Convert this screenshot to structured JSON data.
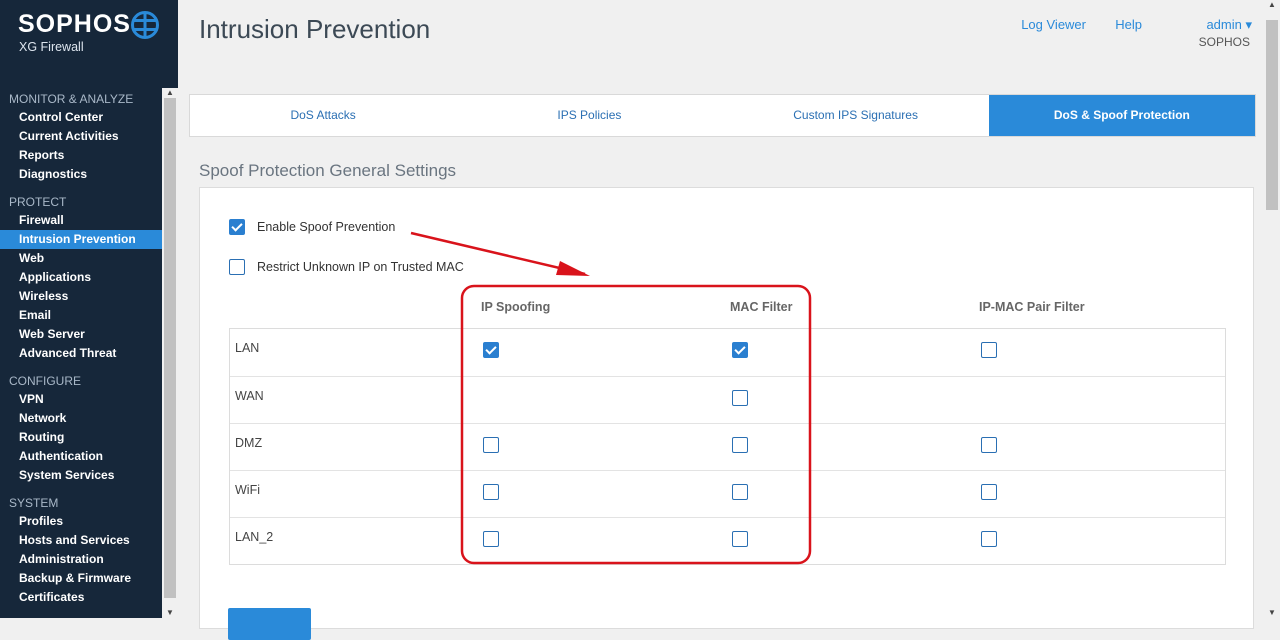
{
  "brand": {
    "name": "SOPHOS",
    "product": "XG Firewall"
  },
  "nav": [
    {
      "heading": "MONITOR & ANALYZE",
      "items": [
        "Control Center",
        "Current Activities",
        "Reports",
        "Diagnostics"
      ]
    },
    {
      "heading": "PROTECT",
      "items": [
        "Firewall",
        "Intrusion Prevention",
        "Web",
        "Applications",
        "Wireless",
        "Email",
        "Web Server",
        "Advanced Threat"
      ]
    },
    {
      "heading": "CONFIGURE",
      "items": [
        "VPN",
        "Network",
        "Routing",
        "Authentication",
        "System Services"
      ]
    },
    {
      "heading": "SYSTEM",
      "items": [
        "Profiles",
        "Hosts and Services",
        "Administration",
        "Backup & Firmware",
        "Certificates"
      ]
    }
  ],
  "active_nav": "Intrusion Prevention",
  "page_title": "Intrusion Prevention",
  "top_links": {
    "log_viewer": "Log Viewer",
    "help": "Help",
    "admin": "admin ▾",
    "org": "SOPHOS"
  },
  "tabs": [
    "DoS Attacks",
    "IPS Policies",
    "Custom IPS Signatures",
    "DoS & Spoof Protection"
  ],
  "active_tab": "DoS & Spoof Protection",
  "section_title": "Spoof Protection General Settings",
  "options": {
    "enable_spoof": {
      "label": "Enable Spoof Prevention",
      "checked": true
    },
    "restrict_unknown": {
      "label": "Restrict Unknown IP on Trusted MAC",
      "checked": false
    }
  },
  "columns": [
    "IP Spoofing",
    "MAC Filter",
    "IP-MAC Pair Filter"
  ],
  "rows": [
    {
      "zone": "LAN",
      "ip_spoofing": true,
      "mac_filter": true,
      "ip_mac_pair": false
    },
    {
      "zone": "WAN",
      "ip_spoofing": null,
      "mac_filter": false,
      "ip_mac_pair": null
    },
    {
      "zone": "DMZ",
      "ip_spoofing": false,
      "mac_filter": false,
      "ip_mac_pair": false
    },
    {
      "zone": "WiFi",
      "ip_spoofing": false,
      "mac_filter": false,
      "ip_mac_pair": false
    },
    {
      "zone": "LAN_2",
      "ip_spoofing": false,
      "mac_filter": false,
      "ip_mac_pair": false
    }
  ],
  "colors": {
    "sidebar_bg": "#16273a",
    "accent": "#2a8ad9",
    "annotation": "#d9131b"
  }
}
